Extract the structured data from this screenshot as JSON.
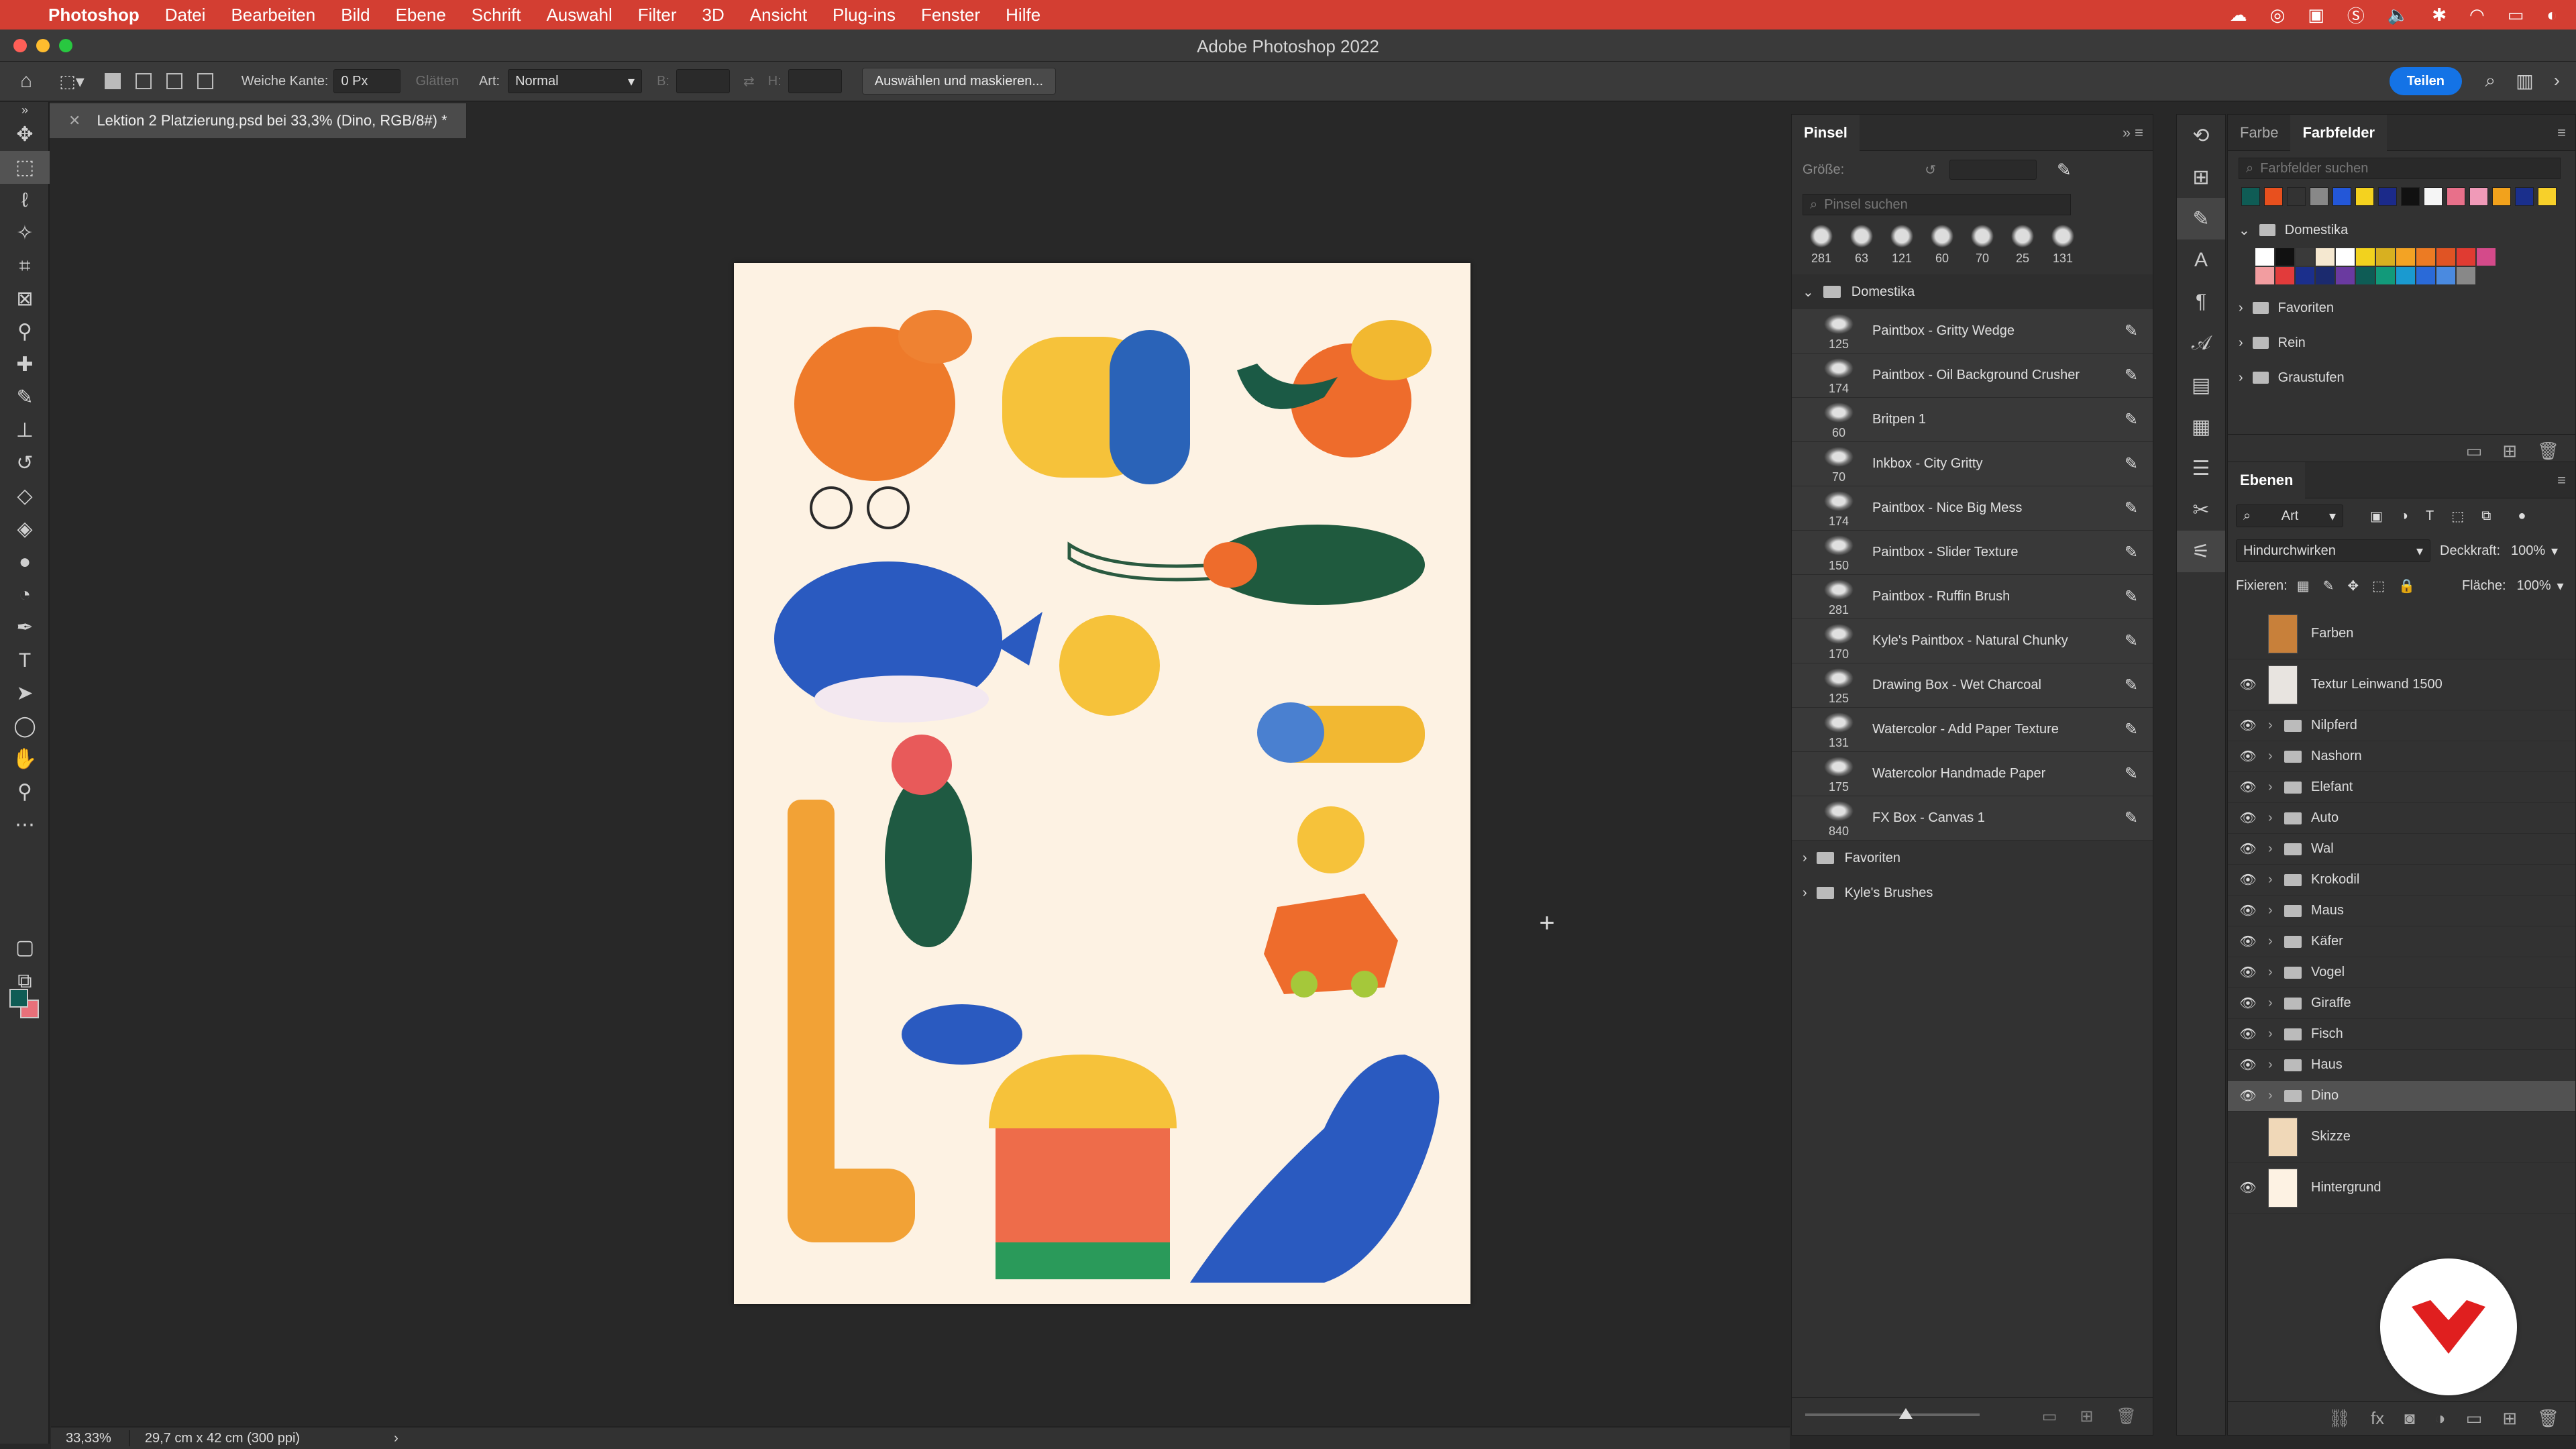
{
  "menubar": {
    "app": "Photoshop",
    "items": [
      "Datei",
      "Bearbeiten",
      "Bild",
      "Ebene",
      "Schrift",
      "Auswahl",
      "Filter",
      "3D",
      "Ansicht",
      "Plug-ins",
      "Fenster",
      "Hilfe"
    ]
  },
  "window": {
    "title": "Adobe Photoshop 2022"
  },
  "options": {
    "feather_label": "Weiche Kante:",
    "feather_value": "0 Px",
    "antialias_label": "Glätten",
    "style_label": "Art:",
    "style_value": "Normal",
    "width_label": "B:",
    "height_label": "H:",
    "select_mask_button": "Auswählen und maskieren...",
    "share_button": "Teilen"
  },
  "document": {
    "tab_title": "Lektion 2 Platzierung.psd bei 33,3% (Dino, RGB/8#) *",
    "zoom": "33,33%",
    "size": "29,7 cm x 42 cm (300 ppi)"
  },
  "colors": {
    "foreground": "#0f5c55",
    "background": "#e8707a",
    "accent": "#1473e6",
    "menubar": "#d33e32"
  },
  "brush_panel": {
    "title": "Pinsel",
    "size_label": "Größe:",
    "search_placeholder": "Pinsel suchen",
    "preset_sizes": [
      "281",
      "63",
      "121",
      "60",
      "70",
      "25",
      "131"
    ],
    "group": "Domestika",
    "brushes": [
      {
        "size": "125",
        "name": "Paintbox - Gritty Wedge"
      },
      {
        "size": "174",
        "name": "Paintbox - Oil Background Crusher"
      },
      {
        "size": "60",
        "name": "Britpen 1"
      },
      {
        "size": "70",
        "name": "Inkbox - City Gritty"
      },
      {
        "size": "174",
        "name": "Paintbox - Nice Big Mess"
      },
      {
        "size": "150",
        "name": "Paintbox - Slider Texture"
      },
      {
        "size": "281",
        "name": "Paintbox - Ruffin Brush"
      },
      {
        "size": "170",
        "name": "Kyle's Paintbox - Natural Chunky"
      },
      {
        "size": "125",
        "name": "Drawing Box - Wet Charcoal"
      },
      {
        "size": "131",
        "name": "Watercolor - Add Paper Texture"
      },
      {
        "size": "175",
        "name": "Watercolor Handmade Paper"
      },
      {
        "size": "840",
        "name": "FX Box - Canvas 1"
      }
    ],
    "other_groups": [
      "Favoriten",
      "Kyle's Brushes"
    ]
  },
  "swatch_panel": {
    "tabs": [
      "Farbe",
      "Farbfelder"
    ],
    "search_placeholder": "Farbfelder suchen",
    "recent": [
      "#0f5c55",
      "#e8501e",
      "#333333",
      "#888888",
      "#2357d8",
      "#f4d21f",
      "#1b2a8a",
      "#111111",
      "#f5f5f5",
      "#e8708a",
      "#f09ab8",
      "#f2a21c",
      "#1a2f8c",
      "#f7d02a"
    ],
    "groups": [
      "Domestika",
      "Favoriten",
      "Rein",
      "Graustufen"
    ],
    "domestika": [
      "#ffffff",
      "#111111",
      "#3a3a3a",
      "#f5e8d0",
      "#ffffff",
      "#f2d21e",
      "#d8b020",
      "#f3a324",
      "#ec7b23",
      "#e05424",
      "#e03b32",
      "#d44a8a",
      "#f29da0",
      "#e23b3b",
      "#1b2f8c",
      "#1b2a6e",
      "#6a3aa0",
      "#0e5c55",
      "#129a7a",
      "#1a9ad0",
      "#2a6ad8",
      "#4a8ae0",
      "#888888"
    ]
  },
  "layers_panel": {
    "title": "Ebenen",
    "filter_value": "Art",
    "blend_mode": "Hindurchwirken",
    "opacity_label": "Deckkraft:",
    "opacity_value": "100%",
    "lock_label": "Fixieren:",
    "fill_label": "Fläche:",
    "fill_value": "100%",
    "layers": [
      {
        "name": "Farben",
        "type": "layer",
        "visible": false
      },
      {
        "name": "Textur Leinwand 1500",
        "type": "layer",
        "visible": true
      },
      {
        "name": "Nilpferd",
        "type": "group",
        "visible": true
      },
      {
        "name": "Nashorn",
        "type": "group",
        "visible": true
      },
      {
        "name": "Elefant",
        "type": "group",
        "visible": true
      },
      {
        "name": "Auto",
        "type": "group",
        "visible": true
      },
      {
        "name": "Wal",
        "type": "group",
        "visible": true
      },
      {
        "name": "Krokodil",
        "type": "group",
        "visible": true
      },
      {
        "name": "Maus",
        "type": "group",
        "visible": true
      },
      {
        "name": "Käfer",
        "type": "group",
        "visible": true
      },
      {
        "name": "Vogel",
        "type": "group",
        "visible": true
      },
      {
        "name": "Giraffe",
        "type": "group",
        "visible": true
      },
      {
        "name": "Fisch",
        "type": "group",
        "visible": true
      },
      {
        "name": "Haus",
        "type": "group",
        "visible": true
      },
      {
        "name": "Dino",
        "type": "group",
        "visible": true,
        "selected": true
      },
      {
        "name": "Skizze",
        "type": "layer",
        "visible": false
      },
      {
        "name": "Hintergrund",
        "type": "layer",
        "visible": true
      }
    ]
  }
}
